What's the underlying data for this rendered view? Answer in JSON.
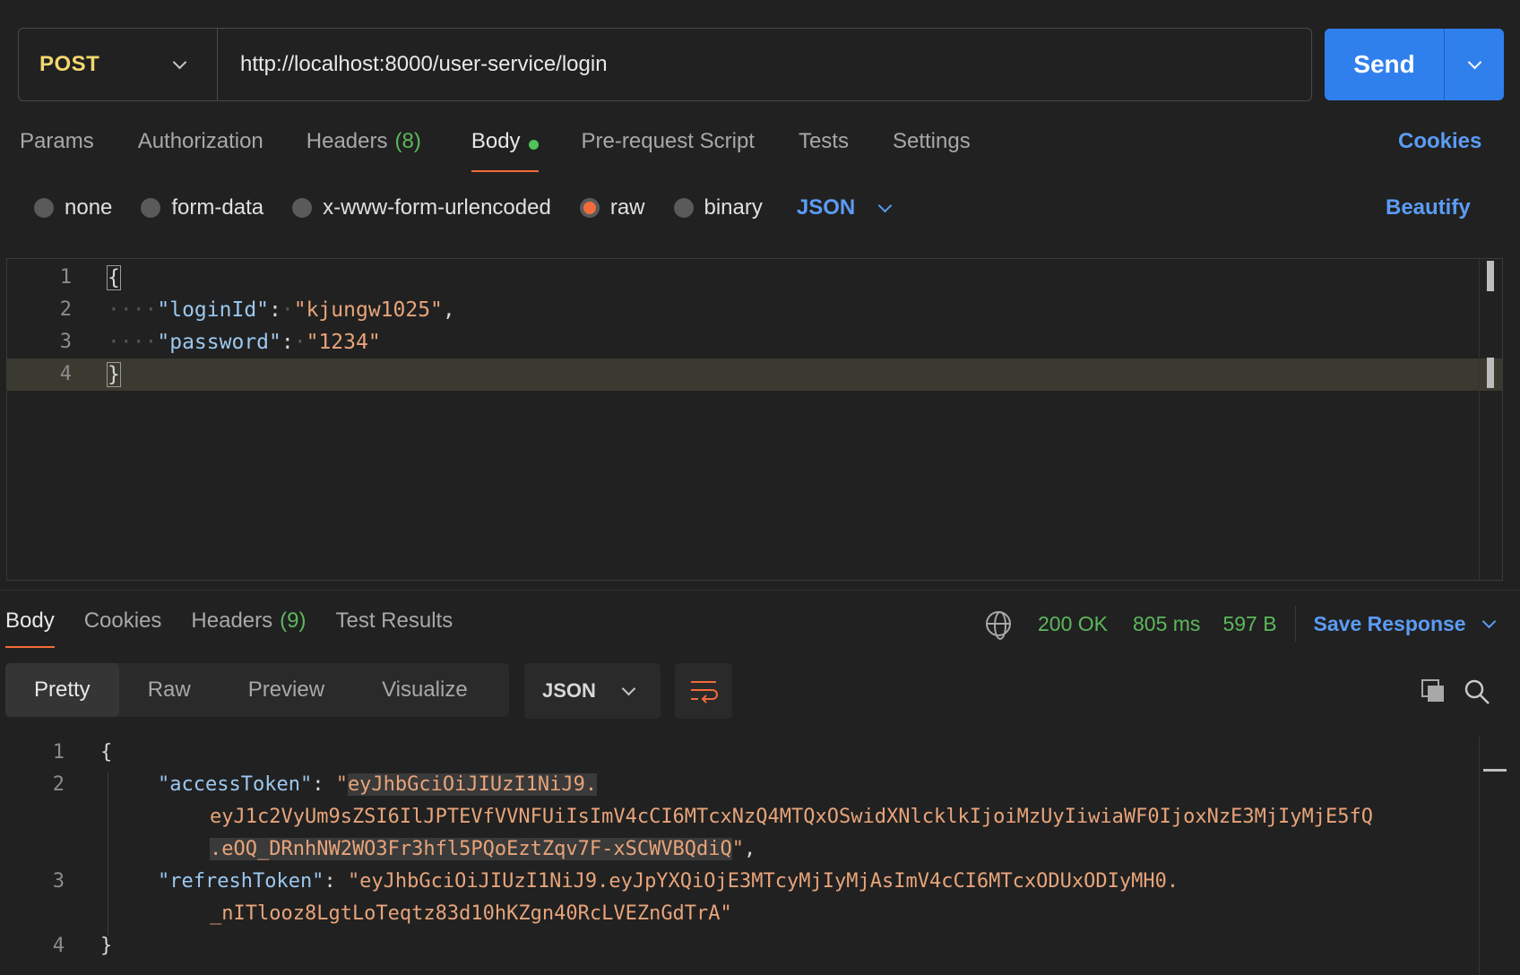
{
  "request": {
    "method": "POST",
    "url": "http://localhost:8000/user-service/login",
    "send_label": "Send"
  },
  "request_tabs": {
    "params": "Params",
    "authorization": "Authorization",
    "headers": "Headers",
    "headers_count": "(8)",
    "body": "Body",
    "pre_request": "Pre-request Script",
    "tests": "Tests",
    "settings": "Settings",
    "cookies": "Cookies"
  },
  "body_types": {
    "none": "none",
    "form_data": "form-data",
    "urlencoded": "x-www-form-urlencoded",
    "raw": "raw",
    "binary": "binary",
    "format": "JSON",
    "beautify": "Beautify"
  },
  "request_body": {
    "line_numbers": [
      "1",
      "2",
      "3",
      "4"
    ],
    "open": "{",
    "close": "}",
    "key1": "\"loginId\"",
    "val1": "\"kjungw1025\"",
    "key2": "\"password\"",
    "val2": "\"1234\""
  },
  "response_tabs": {
    "body": "Body",
    "cookies": "Cookies",
    "headers": "Headers",
    "headers_count": "(9)",
    "test_results": "Test Results"
  },
  "response_status": {
    "status": "200 OK",
    "time": "805 ms",
    "size": "597 B",
    "save_response": "Save Response"
  },
  "view_modes": {
    "pretty": "Pretty",
    "raw": "Raw",
    "preview": "Preview",
    "visualize": "Visualize",
    "format": "JSON"
  },
  "response_body": {
    "line_numbers": [
      "1",
      "2",
      "3",
      "4"
    ],
    "open": "{",
    "close": "}",
    "access_key": "\"accessToken\"",
    "access_p1": "eyJhbGciOiJIUzI1NiJ9.",
    "access_p2": "eyJ1c2VyUm9sZSI6IlJPTEVfVVNFUiIsImV4cCI6MTcxNzQ4MTQxOSwidXNlcklkIjoiMzUyIiwiaWF0IjoxNzE3MjIyMjE5fQ",
    "access_p3": ".eOQ_DRnhNW2WO3Fr3hfl5PQoEztZqv7F-xSCWVBQdiQ",
    "refresh_key": "\"refreshToken\"",
    "refresh_p1": "\"eyJhbGciOiJIUzI1NiJ9.eyJpYXQiOjE3MTcyMjIyMjAsImV4cCI6MTcxODUxODIyMH0.",
    "refresh_p2": "_nITlooz8LgtLoTeqtz83d10hKZgn40RcLVEZnGdTrA\""
  },
  "colors": {
    "accent_blue": "#2f80ed",
    "method_yellow": "#f3d76e",
    "active_orange": "#f26b3a",
    "success_green": "#5cb85c"
  }
}
